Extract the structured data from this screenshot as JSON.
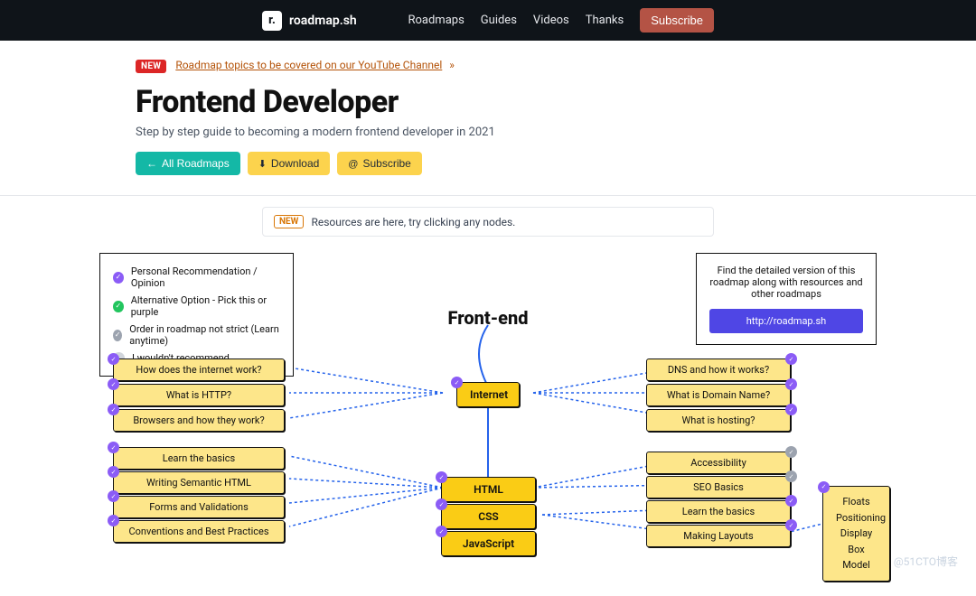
{
  "header": {
    "logo_mark": "r.",
    "logo_text": "roadmap.sh",
    "nav": [
      "Roadmaps",
      "Guides",
      "Videos",
      "Thanks"
    ],
    "subscribe": "Subscribe"
  },
  "banner": {
    "badge": "NEW",
    "link_text": "Roadmap topics to be covered on our YouTube Channel",
    "arrow": "»"
  },
  "page": {
    "title": "Frontend Developer",
    "subtitle": "Step by step guide to becoming a modern frontend developer in 2021"
  },
  "actions": {
    "all": "All Roadmaps",
    "download": "Download",
    "subscribe": "Subscribe"
  },
  "info": {
    "badge": "NEW",
    "text": "Resources are here, try clicking any nodes."
  },
  "legend": {
    "items": [
      {
        "color": "purple",
        "label": "Personal Recommendation / Opinion"
      },
      {
        "color": "green",
        "label": "Alternative Option - Pick this or purple"
      },
      {
        "color": "gray",
        "label": "Order in roadmap not strict (Learn anytime)"
      },
      {
        "color": "lightgray",
        "label": "I wouldn't recommend"
      }
    ]
  },
  "promo": {
    "text": "Find the detailed version of this roadmap along with resources and other roadmaps",
    "button": "http://roadmap.sh"
  },
  "roadmap": {
    "root": "Front-end",
    "internet": {
      "label": "Internet",
      "left": [
        "How does the internet work?",
        "What is HTTP?",
        "Browsers and how they work?"
      ],
      "right": [
        "DNS and how it works?",
        "What is Domain Name?",
        "What is hosting?"
      ]
    },
    "html": {
      "label": "HTML",
      "left": [
        "Learn the basics",
        "Writing Semantic HTML",
        "Forms and Validations",
        "Conventions and Best Practices"
      ],
      "right": [
        "Accessibility",
        "SEO Basics",
        "Learn the basics",
        "Making Layouts"
      ]
    },
    "css": {
      "label": "CSS",
      "detail": [
        "Floats",
        "Positioning",
        "Display",
        "Box Model"
      ]
    },
    "js": {
      "label": "JavaScript"
    }
  },
  "watermark": "@51CTO博客"
}
